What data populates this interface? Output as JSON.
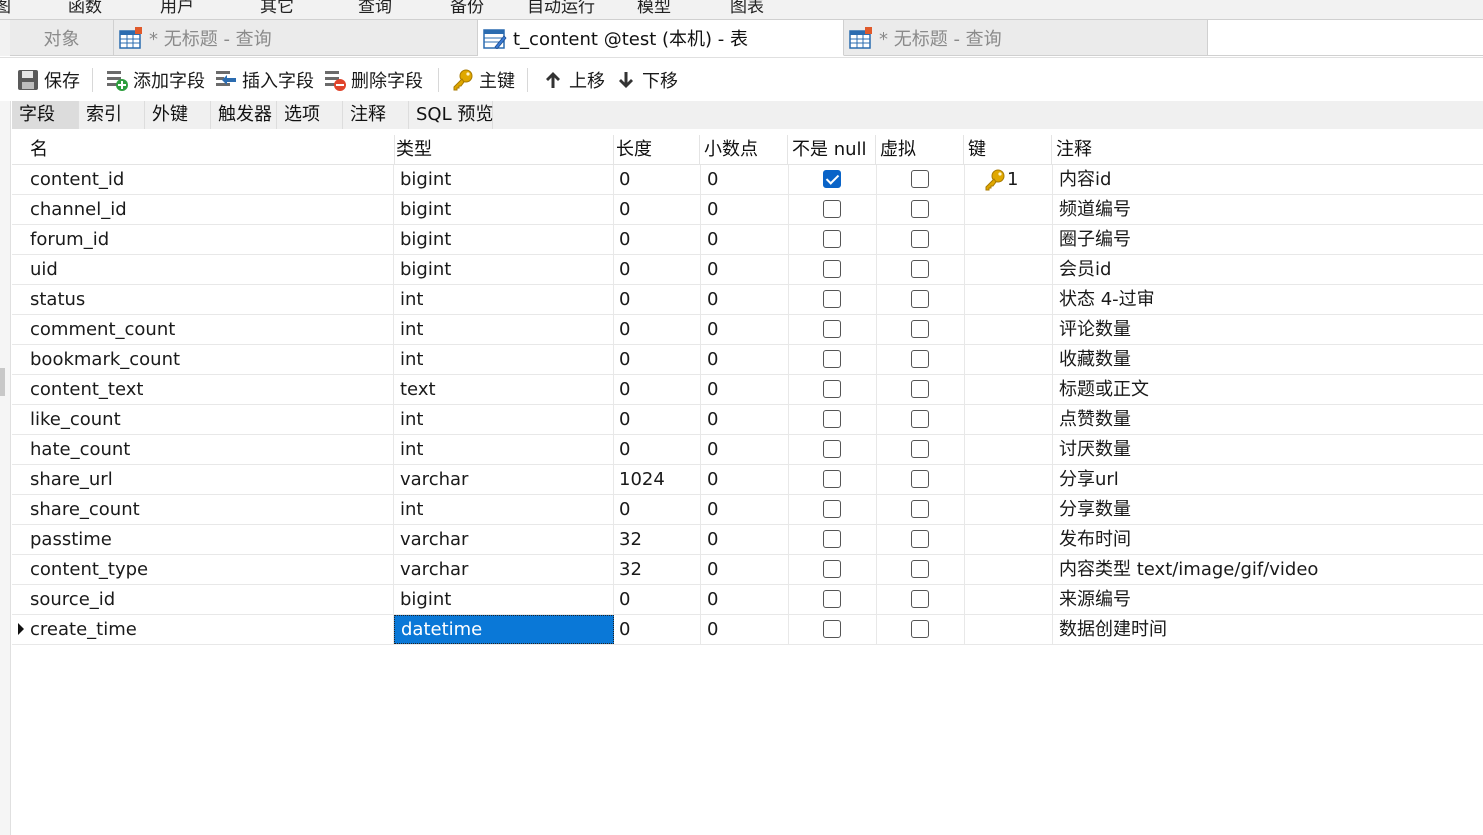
{
  "menu": {
    "items": [
      "图",
      "函数",
      "用户",
      "其它",
      "查询",
      "备份",
      "自动运行",
      "模型",
      "图表"
    ]
  },
  "tabs": [
    {
      "label": "对象",
      "icon": "none",
      "active": false
    },
    {
      "label": "* 无标题 - 查询",
      "icon": "query-table-icon",
      "active": false
    },
    {
      "label": "t_content @test (本机) - 表",
      "icon": "table-design-icon",
      "active": true
    },
    {
      "label": "* 无标题 - 查询",
      "icon": "query-table-icon",
      "active": false
    }
  ],
  "toolbar": {
    "save": "保存",
    "add_field": "添加字段",
    "insert_field": "插入字段",
    "delete_field": "删除字段",
    "primary_key": "主键",
    "move_up": "上移",
    "move_down": "下移"
  },
  "subtabs": [
    "字段",
    "索引",
    "外键",
    "触发器",
    "选项",
    "注释",
    "SQL 预览"
  ],
  "grid": {
    "headers": [
      "名",
      "类型",
      "长度",
      "小数点",
      "不是 null",
      "虚拟",
      "键",
      "注释"
    ],
    "rows": [
      {
        "name": "content_id",
        "type": "bigint",
        "length": "0",
        "decimals": "0",
        "not_null": true,
        "virtual": false,
        "key": "1",
        "comment": "内容id"
      },
      {
        "name": "channel_id",
        "type": "bigint",
        "length": "0",
        "decimals": "0",
        "not_null": false,
        "virtual": false,
        "key": "",
        "comment": "频道编号"
      },
      {
        "name": "forum_id",
        "type": "bigint",
        "length": "0",
        "decimals": "0",
        "not_null": false,
        "virtual": false,
        "key": "",
        "comment": "圈子编号"
      },
      {
        "name": "uid",
        "type": "bigint",
        "length": "0",
        "decimals": "0",
        "not_null": false,
        "virtual": false,
        "key": "",
        "comment": "会员id"
      },
      {
        "name": "status",
        "type": "int",
        "length": "0",
        "decimals": "0",
        "not_null": false,
        "virtual": false,
        "key": "",
        "comment": "状态 4-过审"
      },
      {
        "name": "comment_count",
        "type": "int",
        "length": "0",
        "decimals": "0",
        "not_null": false,
        "virtual": false,
        "key": "",
        "comment": "评论数量"
      },
      {
        "name": "bookmark_count",
        "type": "int",
        "length": "0",
        "decimals": "0",
        "not_null": false,
        "virtual": false,
        "key": "",
        "comment": "收藏数量"
      },
      {
        "name": "content_text",
        "type": "text",
        "length": "0",
        "decimals": "0",
        "not_null": false,
        "virtual": false,
        "key": "",
        "comment": "标题或正文"
      },
      {
        "name": "like_count",
        "type": "int",
        "length": "0",
        "decimals": "0",
        "not_null": false,
        "virtual": false,
        "key": "",
        "comment": "点赞数量"
      },
      {
        "name": "hate_count",
        "type": "int",
        "length": "0",
        "decimals": "0",
        "not_null": false,
        "virtual": false,
        "key": "",
        "comment": "讨厌数量"
      },
      {
        "name": "share_url",
        "type": "varchar",
        "length": "1024",
        "decimals": "0",
        "not_null": false,
        "virtual": false,
        "key": "",
        "comment": "分享url"
      },
      {
        "name": "share_count",
        "type": "int",
        "length": "0",
        "decimals": "0",
        "not_null": false,
        "virtual": false,
        "key": "",
        "comment": "分享数量"
      },
      {
        "name": "passtime",
        "type": "varchar",
        "length": "32",
        "decimals": "0",
        "not_null": false,
        "virtual": false,
        "key": "",
        "comment": "发布时间"
      },
      {
        "name": "content_type",
        "type": "varchar",
        "length": "32",
        "decimals": "0",
        "not_null": false,
        "virtual": false,
        "key": "",
        "comment": "内容类型 text/image/gif/video"
      },
      {
        "name": "source_id",
        "type": "bigint",
        "length": "0",
        "decimals": "0",
        "not_null": false,
        "virtual": false,
        "key": "",
        "comment": "来源编号"
      },
      {
        "name": "create_time",
        "type": "datetime",
        "length": "0",
        "decimals": "0",
        "not_null": false,
        "virtual": false,
        "key": "",
        "comment": "数据创建时间",
        "current": true
      }
    ]
  },
  "colors": {
    "selection": "#0a78d7",
    "checkbox_checked": "#0a64c8",
    "key_icon": "#e0a800"
  }
}
